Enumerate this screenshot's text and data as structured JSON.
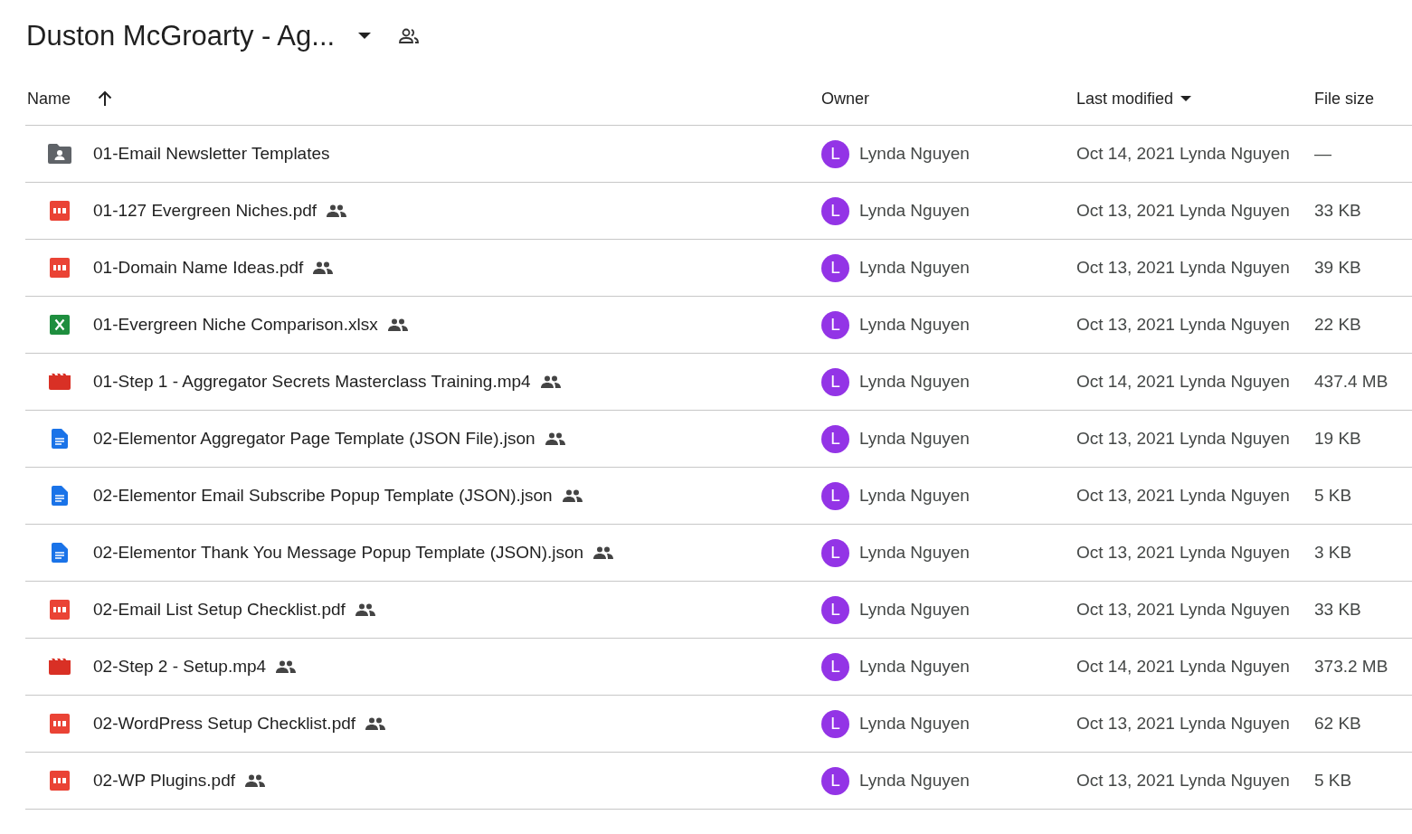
{
  "title": "Duston McGroarty - Ag...",
  "columns": [
    {
      "label": "Name",
      "kind": "sort-up"
    },
    {
      "label": "Owner",
      "kind": "plain"
    },
    {
      "label": "Last modified",
      "kind": "sort-down"
    },
    {
      "label": "File size",
      "kind": "plain"
    }
  ],
  "rows": [
    {
      "kind": "folder",
      "name": "01-Email Newsletter Templates",
      "shared": false,
      "avatar": "L",
      "owner": "Lynda Nguyen",
      "modified": "Oct 14, 2021 Lynda Nguyen",
      "size": "—"
    },
    {
      "kind": "pdf",
      "name": "01-127 Evergreen Niches.pdf",
      "shared": true,
      "avatar": "L",
      "owner": "Lynda Nguyen",
      "modified": "Oct 13, 2021 Lynda Nguyen",
      "size": "33 KB"
    },
    {
      "kind": "pdf",
      "name": "01-Domain Name Ideas.pdf",
      "shared": true,
      "avatar": "L",
      "owner": "Lynda Nguyen",
      "modified": "Oct 13, 2021 Lynda Nguyen",
      "size": "39 KB"
    },
    {
      "kind": "sheet",
      "name": "01-Evergreen Niche Comparison.xlsx",
      "shared": true,
      "avatar": "L",
      "owner": "Lynda Nguyen",
      "modified": "Oct 13, 2021 Lynda Nguyen",
      "size": "22 KB"
    },
    {
      "kind": "video",
      "name": "01-Step 1 - Aggregator Secrets Masterclass Training.mp4",
      "shared": true,
      "avatar": "L",
      "owner": "Lynda Nguyen",
      "modified": "Oct 14, 2021 Lynda Nguyen",
      "size": "437.4 MB"
    },
    {
      "kind": "doc",
      "name": "02-Elementor Aggregator Page Template (JSON File).json",
      "shared": true,
      "avatar": "L",
      "owner": "Lynda Nguyen",
      "modified": "Oct 13, 2021 Lynda Nguyen",
      "size": "19 KB"
    },
    {
      "kind": "doc",
      "name": "02-Elementor Email Subscribe Popup Template (JSON).json",
      "shared": true,
      "avatar": "L",
      "owner": "Lynda Nguyen",
      "modified": "Oct 13, 2021 Lynda Nguyen",
      "size": "5 KB"
    },
    {
      "kind": "doc",
      "name": "02-Elementor Thank You Message Popup Template (JSON).json",
      "shared": true,
      "avatar": "L",
      "owner": "Lynda Nguyen",
      "modified": "Oct 13, 2021 Lynda Nguyen",
      "size": "3 KB"
    },
    {
      "kind": "pdf",
      "name": "02-Email List Setup Checklist.pdf",
      "shared": true,
      "avatar": "L",
      "owner": "Lynda Nguyen",
      "modified": "Oct 13, 2021 Lynda Nguyen",
      "size": "33 KB"
    },
    {
      "kind": "video",
      "name": "02-Step 2 - Setup.mp4",
      "shared": true,
      "avatar": "L",
      "owner": "Lynda Nguyen",
      "modified": "Oct 14, 2021 Lynda Nguyen",
      "size": "373.2 MB"
    },
    {
      "kind": "pdf",
      "name": "02-WordPress Setup Checklist.pdf",
      "shared": true,
      "avatar": "L",
      "owner": "Lynda Nguyen",
      "modified": "Oct 13, 2021 Lynda Nguyen",
      "size": "62 KB"
    },
    {
      "kind": "pdf",
      "name": "02-WP Plugins.pdf",
      "shared": true,
      "avatar": "L",
      "owner": "Lynda Nguyen",
      "modified": "Oct 13, 2021 Lynda Nguyen",
      "size": "5 KB"
    }
  ]
}
